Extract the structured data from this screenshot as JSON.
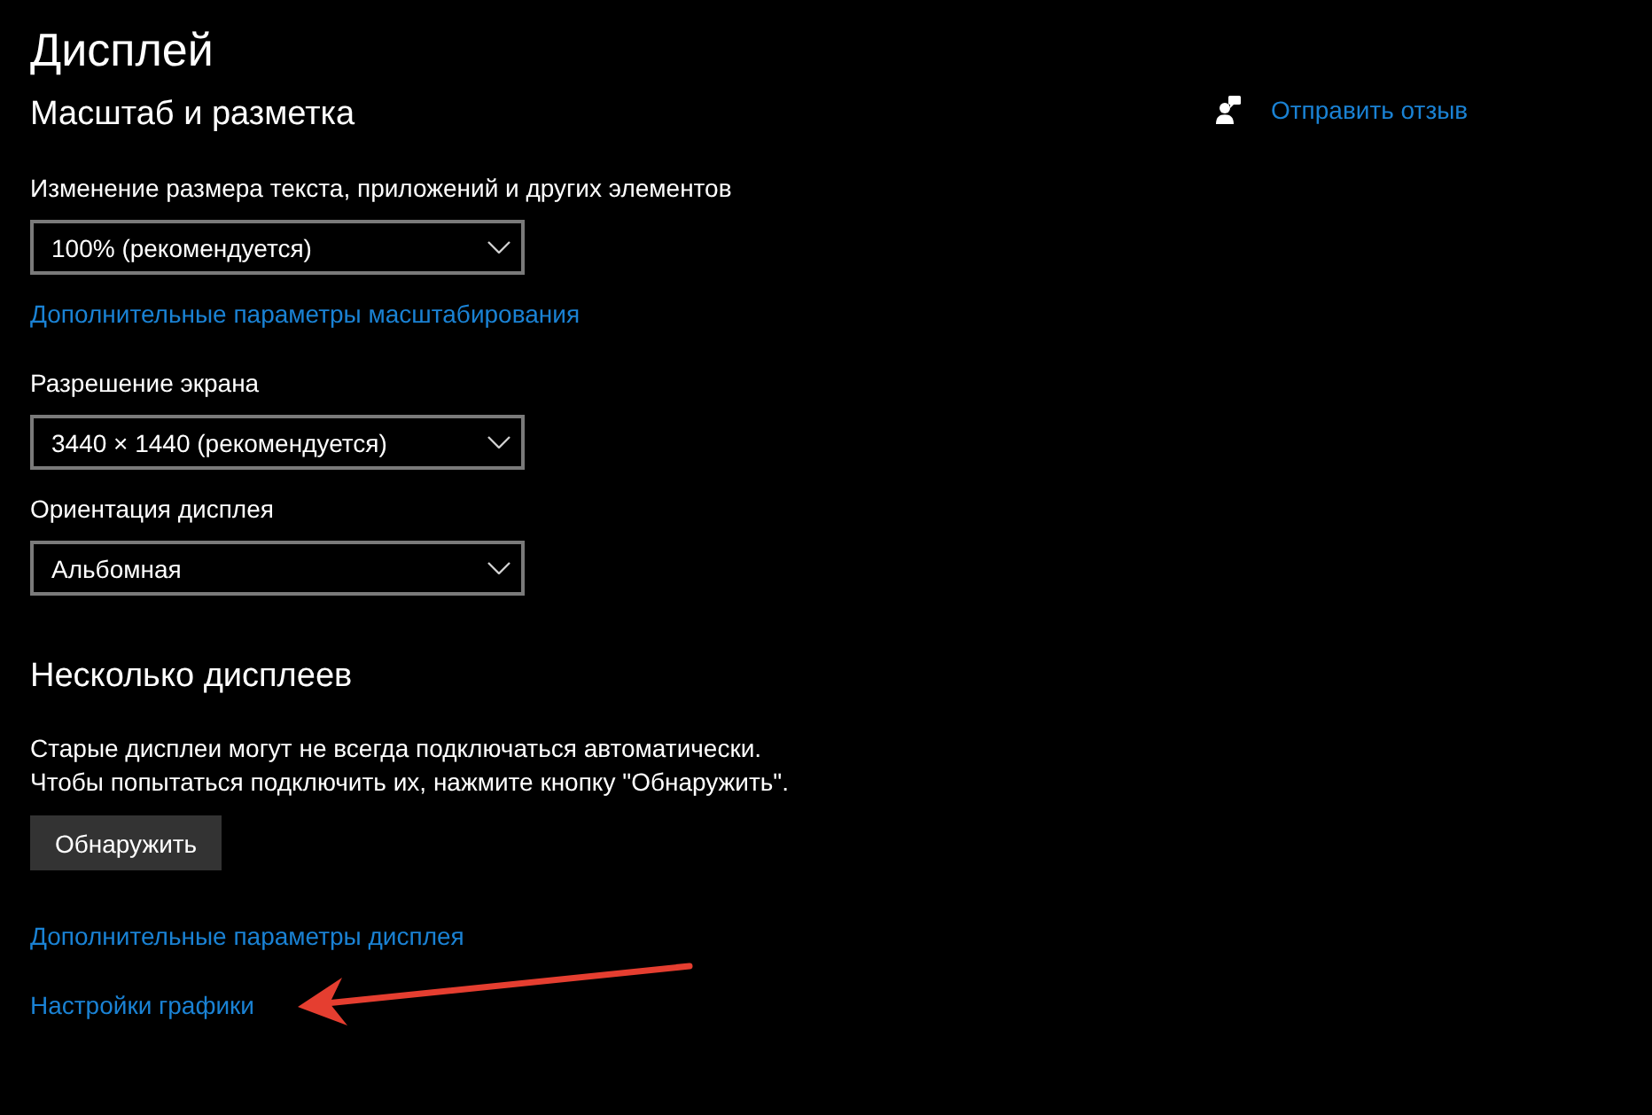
{
  "page": {
    "title": "Дисплей"
  },
  "sections": [
    {
      "heading": "Масштаб и разметка",
      "items": [
        {
          "kind": "label",
          "text": "Изменение размера текста, приложений и других элементов"
        },
        {
          "kind": "dropdown",
          "value": "100% (рекомендуется)"
        },
        {
          "kind": "link",
          "text": "Дополнительные параметры масштабирования"
        },
        {
          "kind": "label",
          "text": "Разрешение экрана"
        },
        {
          "kind": "dropdown",
          "value": "3440 × 1440 (рекомендуется)"
        },
        {
          "kind": "label",
          "text": "Ориентация дисплея"
        },
        {
          "kind": "dropdown",
          "value": "Альбомная"
        }
      ]
    },
    {
      "heading": "Несколько дисплеев",
      "items": [
        {
          "kind": "paragraph",
          "lines": [
            "Старые дисплеи могут не всегда подключаться автоматически.",
            "Чтобы попытаться подключить их, нажмите кнопку \"Обнаружить\"."
          ]
        },
        {
          "kind": "button",
          "text": "Обнаружить"
        },
        {
          "kind": "link",
          "text": "Дополнительные параметры дисплея"
        },
        {
          "kind": "link",
          "text": "Настройки графики"
        }
      ]
    }
  ],
  "feedback_link": {
    "text": "Отправить отзыв"
  }
}
